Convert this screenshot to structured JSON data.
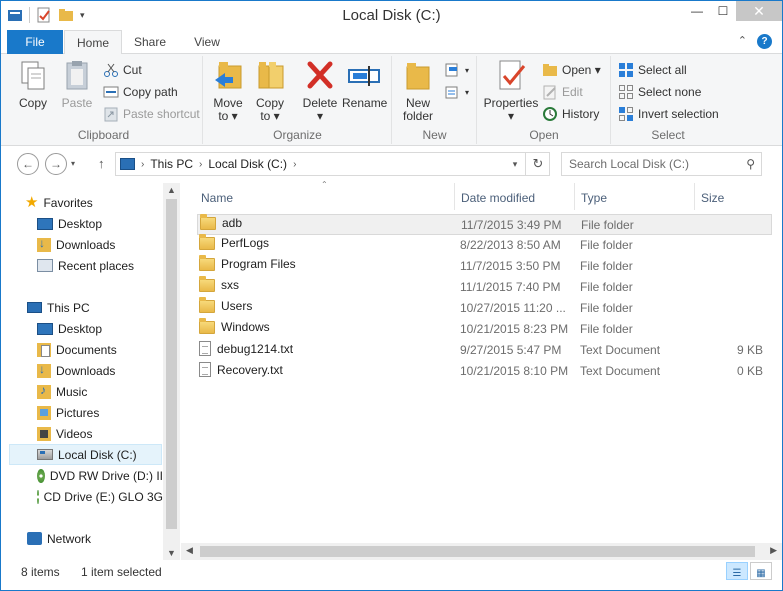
{
  "window": {
    "title": "Local Disk (C:)"
  },
  "window_controls": {
    "minimize": "—",
    "maximize": "☐",
    "close": "✕"
  },
  "tabs": {
    "file": "File",
    "home": "Home",
    "share": "Share",
    "view": "View"
  },
  "ribbon": {
    "clipboard": {
      "label": "Clipboard",
      "copy": "Copy",
      "paste": "Paste",
      "cut": "Cut",
      "copy_path": "Copy path",
      "paste_shortcut": "Paste shortcut"
    },
    "organize": {
      "label": "Organize",
      "move_to_1": "Move",
      "move_to_2": "to ▾",
      "copy_to_1": "Copy",
      "copy_to_2": "to ▾",
      "delete_1": "Delete",
      "delete_2": "▾",
      "rename": "Rename"
    },
    "new": {
      "label": "New",
      "new_folder_1": "New",
      "new_folder_2": "folder"
    },
    "open": {
      "label": "Open",
      "properties_1": "Properties",
      "properties_2": "▾",
      "open": "Open ▾",
      "edit": "Edit",
      "history": "History"
    },
    "select": {
      "label": "Select",
      "select_all": "Select all",
      "select_none": "Select none",
      "invert": "Invert selection"
    }
  },
  "address": {
    "segments": [
      "This PC",
      "Local Disk (C:)"
    ],
    "search_placeholder": "Search Local Disk (C:)"
  },
  "nav": {
    "favorites": "Favorites",
    "fav_items": [
      "Desktop",
      "Downloads",
      "Recent places"
    ],
    "this_pc": "This PC",
    "pc_items": [
      "Desktop",
      "Documents",
      "Downloads",
      "Music",
      "Pictures",
      "Videos",
      "Local Disk (C:)",
      "DVD RW Drive (D:) II",
      "CD Drive (E:) GLO 3G"
    ],
    "network": "Network"
  },
  "columns": {
    "name": "Name",
    "date": "Date modified",
    "type": "Type",
    "size": "Size"
  },
  "files": [
    {
      "name": "adb",
      "date": "11/7/2015 3:49 PM",
      "type": "File folder",
      "size": "",
      "icon": "folder-icon"
    },
    {
      "name": "PerfLogs",
      "date": "8/22/2013 8:50 AM",
      "type": "File folder",
      "size": "",
      "icon": "folder-icon"
    },
    {
      "name": "Program Files",
      "date": "11/7/2015 3:50 PM",
      "type": "File folder",
      "size": "",
      "icon": "folder-icon"
    },
    {
      "name": "sxs",
      "date": "11/1/2015 7:40 PM",
      "type": "File folder",
      "size": "",
      "icon": "folder-icon"
    },
    {
      "name": "Users",
      "date": "10/27/2015 11:20 ...",
      "type": "File folder",
      "size": "",
      "icon": "folder-icon"
    },
    {
      "name": "Windows",
      "date": "10/21/2015 8:23 PM",
      "type": "File folder",
      "size": "",
      "icon": "folder-icon"
    },
    {
      "name": "debug1214.txt",
      "date": "9/27/2015 5:47 PM",
      "type": "Text Document",
      "size": "9 KB",
      "icon": "text-file-icon"
    },
    {
      "name": "Recovery.txt",
      "date": "10/21/2015 8:10 PM",
      "type": "Text Document",
      "size": "0 KB",
      "icon": "text-file-icon"
    }
  ],
  "status": {
    "items": "8 items",
    "selected": "1 item selected"
  },
  "colors": {
    "accent": "#1979ca",
    "selection": "#e5f3fb"
  }
}
